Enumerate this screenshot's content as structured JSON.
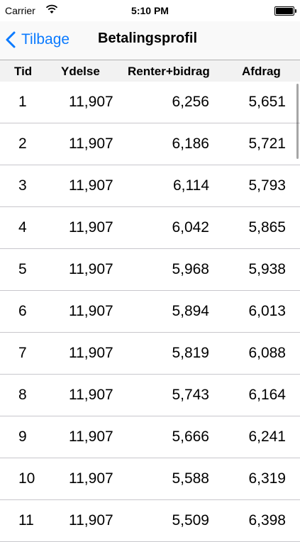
{
  "status": {
    "carrier": "Carrier",
    "time": "5:10 PM"
  },
  "nav": {
    "back_label": "Tilbage",
    "title": "Betalingsprofil"
  },
  "columns": [
    "Tid",
    "Ydelse",
    "Renter+bidrag",
    "Afdrag"
  ],
  "rows": [
    [
      "1",
      "11,907",
      "6,256",
      "5,651"
    ],
    [
      "2",
      "11,907",
      "6,186",
      "5,721"
    ],
    [
      "3",
      "11,907",
      "6,114",
      "5,793"
    ],
    [
      "4",
      "11,907",
      "6,042",
      "5,865"
    ],
    [
      "5",
      "11,907",
      "5,968",
      "5,938"
    ],
    [
      "6",
      "11,907",
      "5,894",
      "6,013"
    ],
    [
      "7",
      "11,907",
      "5,819",
      "6,088"
    ],
    [
      "8",
      "11,907",
      "5,743",
      "6,164"
    ],
    [
      "9",
      "11,907",
      "5,666",
      "6,241"
    ],
    [
      "10",
      "11,907",
      "5,588",
      "6,319"
    ],
    [
      "11",
      "11,907",
      "5,509",
      "6,398"
    ]
  ],
  "colors": {
    "accent": "#0a7aff"
  }
}
